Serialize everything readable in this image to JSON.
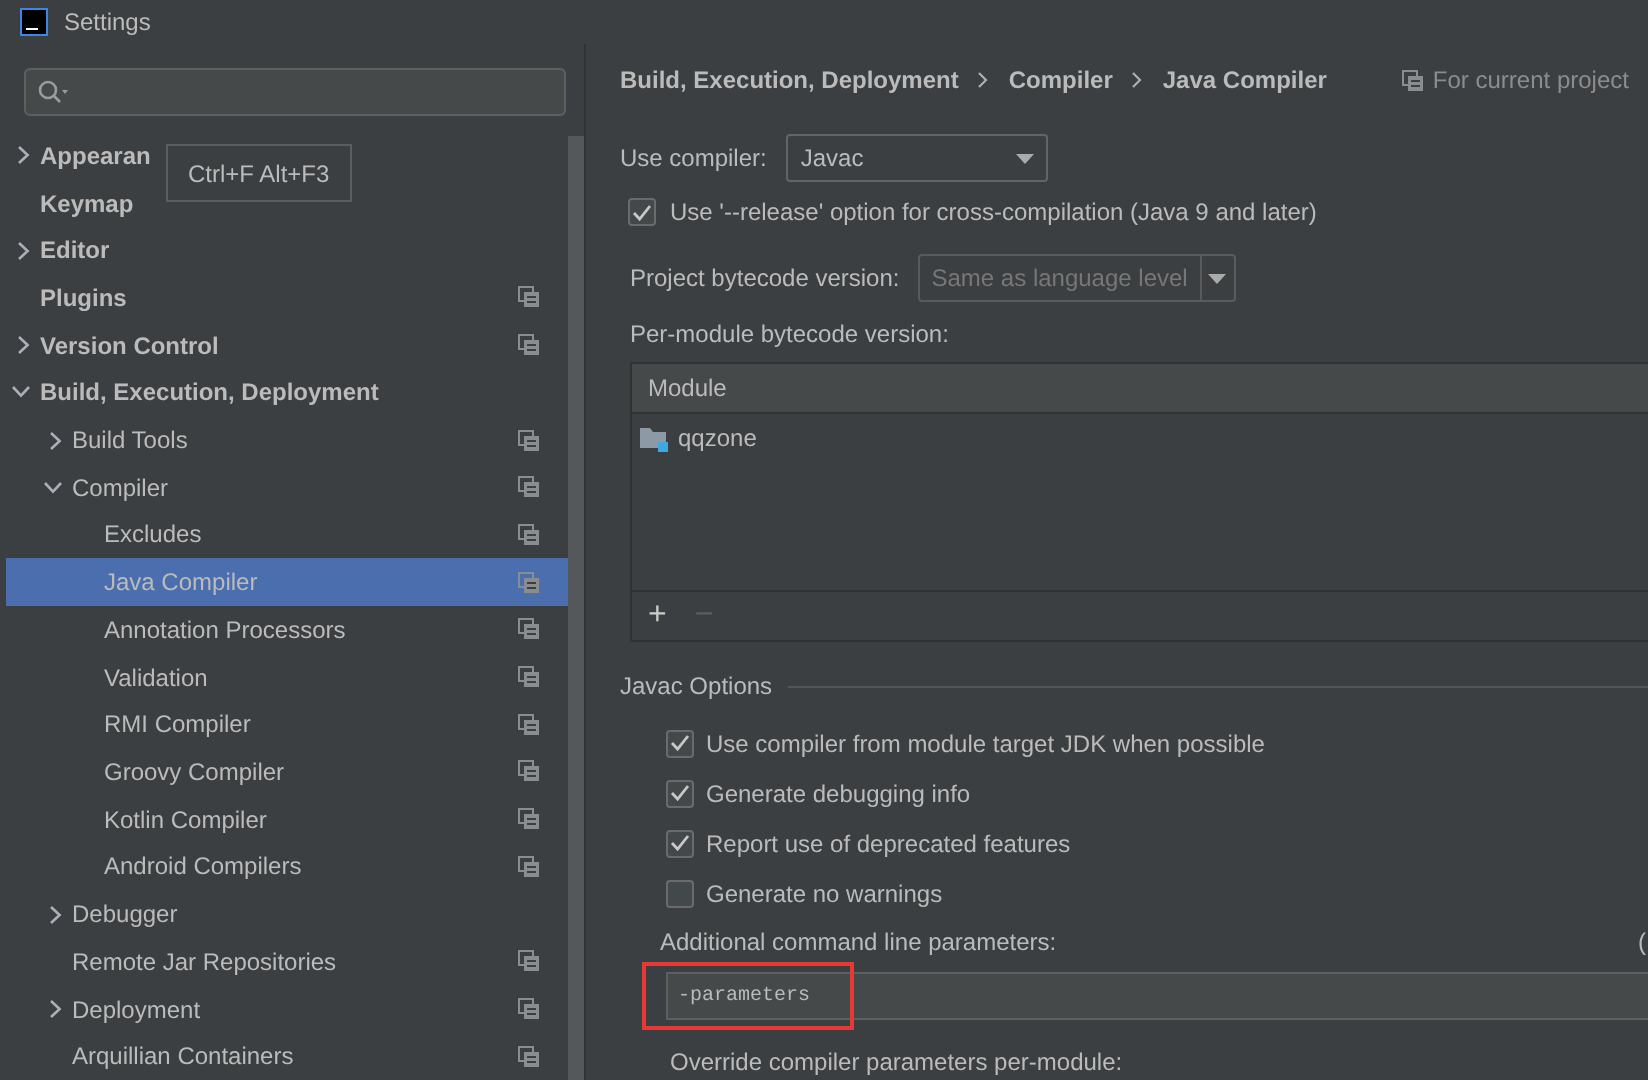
{
  "window": {
    "title": "Settings"
  },
  "tooltip": {
    "text": "Ctrl+F Alt+F3"
  },
  "sidebar": {
    "items": [
      {
        "label": "Appearan",
        "expanded": false,
        "project_icon": false,
        "selected": false
      },
      {
        "label": "Keymap",
        "project_icon": false,
        "selected": false
      },
      {
        "label": "Editor",
        "expanded": false,
        "project_icon": false,
        "selected": false
      },
      {
        "label": "Plugins",
        "project_icon": true,
        "selected": false
      },
      {
        "label": "Version Control",
        "expanded": false,
        "project_icon": true,
        "selected": false
      },
      {
        "label": "Build, Execution, Deployment",
        "expanded": true,
        "project_icon": false,
        "selected": false,
        "children": [
          {
            "label": "Build Tools",
            "expanded": false,
            "project_icon": true,
            "selected": false
          },
          {
            "label": "Compiler",
            "expanded": true,
            "project_icon": true,
            "selected": false,
            "children": [
              {
                "label": "Excludes",
                "project_icon": true,
                "selected": false
              },
              {
                "label": "Java Compiler",
                "project_icon": true,
                "selected": true
              },
              {
                "label": "Annotation Processors",
                "project_icon": true,
                "selected": false
              },
              {
                "label": "Validation",
                "project_icon": true,
                "selected": false
              },
              {
                "label": "RMI Compiler",
                "project_icon": true,
                "selected": false
              },
              {
                "label": "Groovy Compiler",
                "project_icon": true,
                "selected": false
              },
              {
                "label": "Kotlin Compiler",
                "project_icon": true,
                "selected": false
              },
              {
                "label": "Android Compilers",
                "project_icon": true,
                "selected": false
              }
            ]
          },
          {
            "label": "Debugger",
            "expanded": false,
            "project_icon": false,
            "selected": false
          },
          {
            "label": "Remote Jar Repositories",
            "project_icon": true,
            "selected": false
          },
          {
            "label": "Deployment",
            "expanded": false,
            "project_icon": true,
            "selected": false
          },
          {
            "label": "Arquillian Containers",
            "project_icon": true,
            "selected": false
          }
        ]
      }
    ]
  },
  "breadcrumb": [
    "Build, Execution, Deployment",
    "Compiler",
    "Java Compiler"
  ],
  "scope_note": "For current project",
  "use_compiler": {
    "label": "Use compiler:",
    "value": "Javac"
  },
  "release_option": {
    "label": "Use '--release' option for cross-compilation (Java 9 and later)",
    "checked": true
  },
  "project_bytecode": {
    "label": "Project bytecode version:",
    "value": "Same as language level",
    "disabled": true
  },
  "per_module": {
    "label": "Per-module bytecode version:",
    "columns": [
      "Module"
    ],
    "rows": [
      {
        "module": "qqzone"
      }
    ],
    "add": "+",
    "remove": "−",
    "remove_disabled": true
  },
  "javac_options": {
    "title": "Javac Options",
    "checkboxes": [
      {
        "label": "Use compiler from module target JDK when possible",
        "checked": true
      },
      {
        "label": "Generate debugging info",
        "checked": true
      },
      {
        "label": "Report use of deprecated features",
        "checked": true
      },
      {
        "label": "Generate no warnings",
        "checked": false
      }
    ],
    "additional_label": "Additional command line parameters:",
    "edge_text": "(",
    "additional_value": "-parameters",
    "highlighted": true,
    "override_label": "Override compiler parameters per-module:"
  }
}
